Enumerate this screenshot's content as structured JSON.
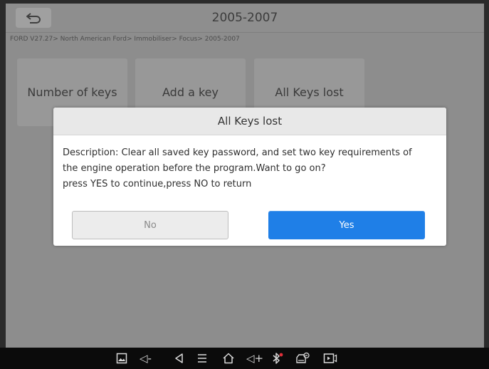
{
  "header": {
    "title": "2005-2007"
  },
  "breadcrumb": "FORD V27.27> North American Ford> Immobiliser> Focus> 2005-2007",
  "functions": [
    {
      "label": "Number of keys"
    },
    {
      "label": "Add a key"
    },
    {
      "label": "All Keys lost"
    }
  ],
  "dialog": {
    "title": "All Keys lost",
    "description_line1": "Description: Clear all saved key password, and set two key requirements of",
    "description_line2": "the engine operation before the program.Want to go on?",
    "description_line3": "press YES to continue,press NO to return",
    "no_label": "No",
    "yes_label": "Yes"
  },
  "navbar": {
    "icons": [
      "gallery-icon",
      "volume-down-icon",
      "back-triangle-icon",
      "menu-icon",
      "home-icon",
      "volume-up-icon",
      "bluetooth-icon",
      "vci-icon",
      "screen-record-icon"
    ],
    "volume_down_text": "◁-",
    "volume_up_text": "◁+"
  },
  "colors": {
    "yes_button": "#1f7fe7",
    "dim_overlay": "#8d8d8d",
    "navbar": "#0b0b0b",
    "bluetooth_dot": "#e0303a"
  }
}
